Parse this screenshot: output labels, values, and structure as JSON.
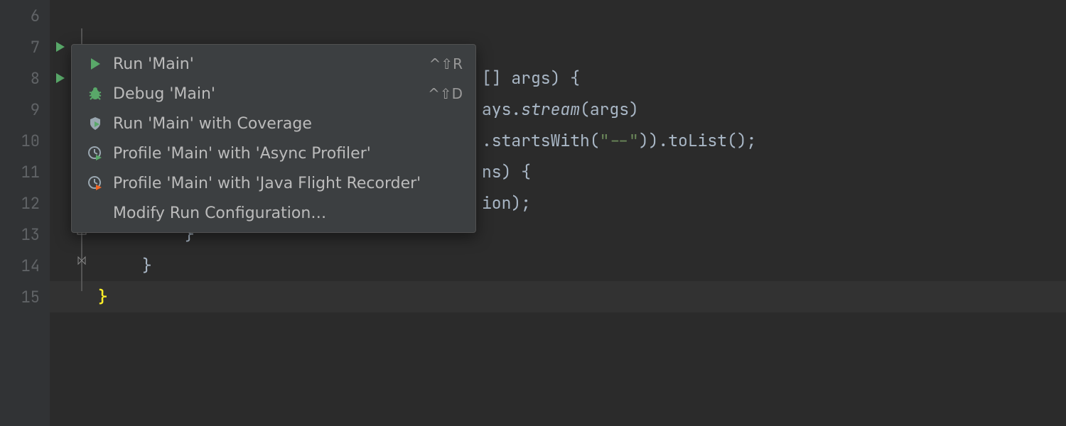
{
  "gutter": {
    "lines": [
      "6",
      "7",
      "8",
      "9",
      "10",
      "11",
      "12",
      "13",
      "14",
      "15"
    ]
  },
  "menu": {
    "items": [
      {
        "label": "Run 'Main'",
        "shortcut": "^⇧R"
      },
      {
        "label": "Debug 'Main'",
        "shortcut": "^⇧D"
      },
      {
        "label": "Run 'Main' with Coverage",
        "shortcut": ""
      },
      {
        "label": "Profile 'Main' with 'Async Profiler'",
        "shortcut": ""
      },
      {
        "label": "Profile 'Main' with 'Java Flight Recorder'",
        "shortcut": ""
      },
      {
        "label": "Modify Run Configuration…",
        "shortcut": ""
      }
    ]
  },
  "code": {
    "l8_a": "[] args) {",
    "l9_a": "ays.",
    "l9_b": "stream",
    "l9_c": "(args)",
    "l10_a": ".startsWith(",
    "l10_b": "\"--\"",
    "l10_c": ")).toList();",
    "l11_a": "ns) {",
    "l12_a": "ion);",
    "l13_a": "}",
    "l14_a": "}",
    "l15_a": "}"
  }
}
